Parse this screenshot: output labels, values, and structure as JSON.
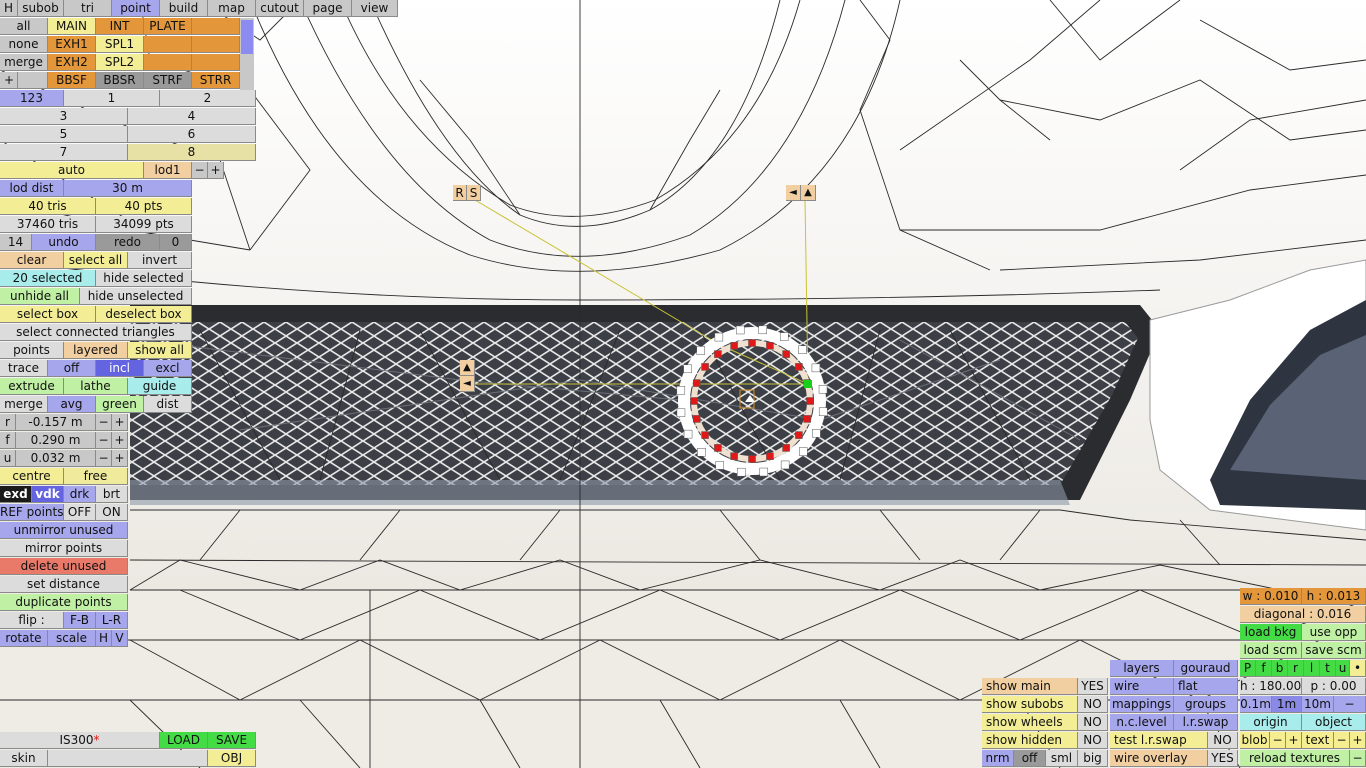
{
  "topbar": {
    "items": [
      {
        "key": "h",
        "label": "H"
      },
      {
        "key": "subob",
        "label": "subob"
      },
      {
        "key": "tri",
        "label": "tri"
      },
      {
        "key": "point",
        "label": "point"
      },
      {
        "key": "build",
        "label": "build"
      },
      {
        "key": "map",
        "label": "map"
      },
      {
        "key": "cutout",
        "label": "cutout"
      },
      {
        "key": "page",
        "label": "page"
      },
      {
        "key": "view",
        "label": "view"
      }
    ]
  },
  "subobjects": {
    "left": [
      "all",
      "none",
      "merge",
      "+"
    ],
    "grid": [
      [
        "MAIN",
        "INT",
        "PLATE",
        ""
      ],
      [
        "EXH1",
        "SPL1",
        "",
        ""
      ],
      [
        "EXH2",
        "SPL2",
        "",
        ""
      ],
      [
        "BBSF",
        "BBSR",
        "STRF",
        "STRR"
      ]
    ]
  },
  "layers": {
    "all": "123",
    "row1": [
      "1",
      "2"
    ],
    "row2": [
      "3",
      "4"
    ],
    "row3": [
      "5",
      "6"
    ],
    "row4": [
      "7",
      "8"
    ]
  },
  "lod": {
    "auto": "auto",
    "lod1": "lod1",
    "minus": "−",
    "plus": "+",
    "dist_label": "lod dist",
    "dist_value": "30 m"
  },
  "stats": {
    "tris": "40 tris",
    "pts": "40 pts",
    "total_tris": "37460 tris",
    "total_pts": "34099 pts"
  },
  "undo": {
    "count": "14",
    "undo": "undo",
    "redo": "redo",
    "redo_count": "0"
  },
  "selection": {
    "clear": "clear",
    "select_all": "select all",
    "invert": "invert",
    "selected": "20 selected",
    "hide_selected": "hide selected",
    "unhide_all": "unhide all",
    "hide_unselected": "hide unselected",
    "select_box": "select box",
    "deselect_box": "deselect box",
    "select_connected": "select connected triangles"
  },
  "modes": {
    "points": "points",
    "layered": "layered",
    "show_all": "show all",
    "trace": "trace",
    "off": "off",
    "incl": "incl",
    "excl": "excl",
    "extrude": "extrude",
    "lathe": "lathe",
    "guide": "guide",
    "merge": "merge",
    "avg": "avg",
    "green": "green",
    "dist": "dist"
  },
  "coords": [
    {
      "axis": "r",
      "value": "-0.157 m"
    },
    {
      "axis": "f",
      "value": "0.290 m"
    },
    {
      "axis": "u",
      "value": "0.032 m"
    }
  ],
  "pivot": {
    "centre": "centre",
    "free": "free"
  },
  "shade": {
    "exd": "exd",
    "vdk": "vdk",
    "drk": "drk",
    "brt": "brt"
  },
  "refpoints": {
    "label": "REF points",
    "off": "OFF",
    "on": "ON"
  },
  "actions": {
    "unmirror": "unmirror unused",
    "mirror": "mirror points",
    "delete": "delete unused",
    "set_distance": "set distance",
    "duplicate": "duplicate points"
  },
  "flip": {
    "label": "flip :",
    "fb": "F-B",
    "lr": "L-R",
    "rotate": "rotate",
    "scale": "scale",
    "h": "H",
    "v": "V"
  },
  "file": {
    "name": "IS300",
    "modified": "*",
    "load": "LOAD",
    "save": "SAVE",
    "skin": "skin",
    "obj": "OBJ"
  },
  "viewport_handles": {
    "rs": [
      "R",
      "S"
    ],
    "arrows_right": [
      "◄",
      "▲"
    ],
    "arrows_left": [
      "▲",
      "◄"
    ]
  },
  "display": {
    "show_main": "show main",
    "show_main_val": "YES",
    "show_subobs": "show subobs",
    "show_subobs_val": "NO",
    "show_wheels": "show wheels",
    "show_wheels_val": "NO",
    "show_hidden": "show hidden",
    "show_hidden_val": "NO",
    "nrm": "nrm",
    "off": "off",
    "sml": "sml",
    "big": "big"
  },
  "render": {
    "layers": "layers",
    "gouraud": "gouraud",
    "wire": "wire",
    "flat": "flat",
    "mappings": "mappings",
    "groups": "groups",
    "nc_level": "n.c.level",
    "lr_swap": "l.r.swap",
    "test_lr_swap": "test l.r.swap",
    "test_lr_swap_val": "NO",
    "wire_overlay": "wire overlay",
    "wire_overlay_val": "YES"
  },
  "measure": {
    "w": "w : 0.010",
    "h": "h : 0.013",
    "diagonal": "diagonal : 0.016",
    "load_bkg": "load bkg",
    "use_opp": "use opp",
    "load_scm": "load scm",
    "save_scm": "save scm",
    "views": [
      "P",
      "f",
      "b",
      "r",
      "l",
      "t",
      "u",
      "•"
    ],
    "heading": "h : 180.00",
    "pitch": "p : 0.00",
    "steps": [
      "0.1m",
      "1m",
      "10m",
      "−"
    ],
    "origin": "origin",
    "object": "object",
    "blob": "blob",
    "text": "text",
    "minus": "−",
    "plus": "+",
    "reload": "reload textures"
  }
}
